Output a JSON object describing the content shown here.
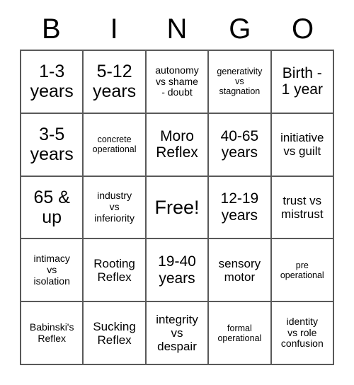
{
  "card": {
    "title": "Bingo Card",
    "header_letters": [
      "B",
      "I",
      "N",
      "G",
      "O"
    ],
    "free_space_label": "Free!",
    "grid_color": "#595959",
    "background_color": "#ffffff",
    "text_color": "#000000",
    "rows": 5,
    "columns": 5,
    "cells": [
      [
        {
          "text": "1-3\nyears",
          "size": "lg",
          "free": false
        },
        {
          "text": "5-12\nyears",
          "size": "lg",
          "free": false
        },
        {
          "text": "autonomy\nvs shame\n- doubt",
          "size": "xs",
          "free": false
        },
        {
          "text": "generativity\nvs\nstagnation",
          "size": "xxs",
          "free": false
        },
        {
          "text": "Birth -\n1 year",
          "size": "md",
          "free": false
        }
      ],
      [
        {
          "text": "3-5\nyears",
          "size": "lg",
          "free": false
        },
        {
          "text": "concrete\noperational",
          "size": "xxs",
          "free": false
        },
        {
          "text": "Moro\nReflex",
          "size": "md",
          "free": false
        },
        {
          "text": "40-65\nyears",
          "size": "md",
          "free": false
        },
        {
          "text": "initiative\nvs guilt",
          "size": "sm",
          "free": false
        }
      ],
      [
        {
          "text": "65 &\nup",
          "size": "lg",
          "free": false
        },
        {
          "text": "industry\nvs\ninferiority",
          "size": "xs",
          "free": false
        },
        {
          "text": "Free!",
          "size": "xl",
          "free": true
        },
        {
          "text": "12-19\nyears",
          "size": "md",
          "free": false
        },
        {
          "text": "trust vs\nmistrust",
          "size": "sm",
          "free": false
        }
      ],
      [
        {
          "text": "intimacy\nvs\nisolation",
          "size": "xs",
          "free": false
        },
        {
          "text": "Rooting\nReflex",
          "size": "sm",
          "free": false
        },
        {
          "text": "19-40\nyears",
          "size": "md",
          "free": false
        },
        {
          "text": "sensory\nmotor",
          "size": "sm",
          "free": false
        },
        {
          "text": "pre\noperational",
          "size": "xxs",
          "free": false
        }
      ],
      [
        {
          "text": "Babinski's\nReflex",
          "size": "xs",
          "free": false
        },
        {
          "text": "Sucking\nReflex",
          "size": "sm",
          "free": false
        },
        {
          "text": "integrity\nvs\ndespair",
          "size": "sm",
          "free": false
        },
        {
          "text": "formal\noperational",
          "size": "xxs",
          "free": false
        },
        {
          "text": "identity\nvs role\nconfusion",
          "size": "xs",
          "free": false
        }
      ]
    ]
  }
}
